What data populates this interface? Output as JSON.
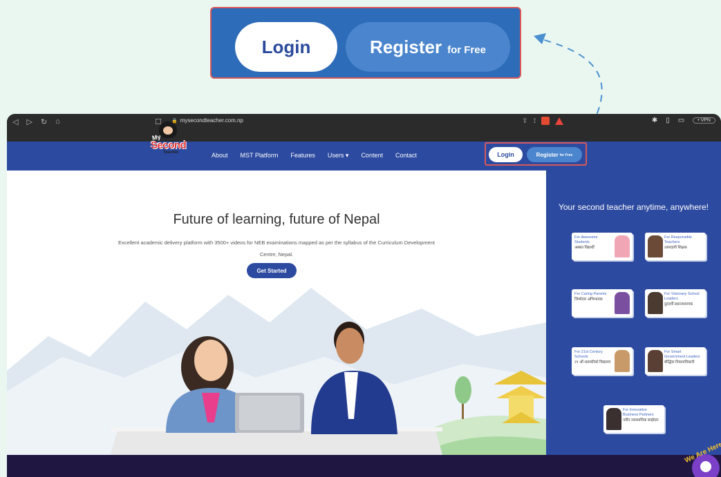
{
  "callout": {
    "login_label": "Login",
    "register_label": "Register",
    "register_sub": "for Free"
  },
  "browser": {
    "url": "mysecondteacher.com.np",
    "vpn_label": "• VPN",
    "nav_icons": [
      "back-icon",
      "forward-icon",
      "reload-icon",
      "home-icon"
    ]
  },
  "site": {
    "logo": {
      "my": "My",
      "second": "Second",
      "teacher": "Teacher"
    },
    "nav": [
      "About",
      "MST Platform",
      "Features",
      "Users ▾",
      "Content",
      "Contact"
    ],
    "login_label": "Login",
    "register_label": "Register",
    "register_sub": "for Free",
    "hero": {
      "title": "Future of learning, future of Nepal",
      "subtitle": "Excellent academic delivery platform with 3500+ videos for NEB examinations mapped as per the syllabus of the Curriculum Development Centre, Nepal.",
      "cta": "Get Started"
    },
    "side": {
      "title": "Your second teacher anytime, anywhere!",
      "cards": [
        {
          "en": "For Awesome Students",
          "np": "अब्बल विद्यार्थी"
        },
        {
          "en": "For Responsible Teachers",
          "np": "उत्तरदायी शिक्षक"
        },
        {
          "en": "For Caring Parents",
          "np": "जिम्मेवार अभिभावक"
        },
        {
          "en": "For Visionary School Leaders",
          "np": "दुरदर्शी प्रधानाध्यापक"
        },
        {
          "en": "For 21st Century Schools",
          "np": "२१ औं शताब्दीको विद्यालय"
        },
        {
          "en": "For Smart Government Leaders",
          "np": "बौद्धिक निकायविकारी"
        },
        {
          "en": "For Innovative Business Partners",
          "np": "नवीन व्यवसायिक साझेदार"
        }
      ]
    },
    "badge_text": "We Are Here"
  }
}
